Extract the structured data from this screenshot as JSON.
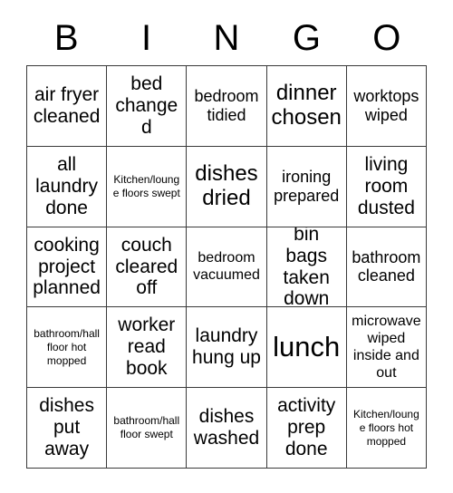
{
  "card": {
    "header_letters": [
      "B",
      "I",
      "N",
      "G",
      "O"
    ],
    "columns": 5,
    "rows": 5,
    "border_color": "#3a3a3a",
    "background_color": "#ffffff",
    "text_color": "#000000",
    "cells": [
      {
        "text": "air fryer cleaned",
        "size": "md"
      },
      {
        "text": "bed changed",
        "size": "md"
      },
      {
        "text": "bedroom tidied",
        "size": "sm"
      },
      {
        "text": "dinner chosen",
        "size": "lg"
      },
      {
        "text": "worktops wiped",
        "size": "sm"
      },
      {
        "text": "all laundry done",
        "size": "md"
      },
      {
        "text": "Kitchen/lounge floors swept",
        "size": "xxs"
      },
      {
        "text": "dishes dried",
        "size": "lg"
      },
      {
        "text": "ironing prepared",
        "size": "sm"
      },
      {
        "text": "living room dusted",
        "size": "md"
      },
      {
        "text": "cooking project planned",
        "size": "md"
      },
      {
        "text": "couch cleared off",
        "size": "md"
      },
      {
        "text": "bedroom vacuumed",
        "size": "xs"
      },
      {
        "text": "bin bags taken down",
        "size": "md"
      },
      {
        "text": "bathroom cleaned",
        "size": "sm"
      },
      {
        "text": "bathroom/hall floor hot mopped",
        "size": "xxs"
      },
      {
        "text": "worker read book",
        "size": "md"
      },
      {
        "text": "laundry hung up",
        "size": "md"
      },
      {
        "text": "lunch",
        "size": "xl"
      },
      {
        "text": "microwave wiped inside and out",
        "size": "xs"
      },
      {
        "text": "dishes put away",
        "size": "md"
      },
      {
        "text": "bathroom/hall floor swept",
        "size": "xxs"
      },
      {
        "text": "dishes washed",
        "size": "md"
      },
      {
        "text": "activity prep done",
        "size": "md"
      },
      {
        "text": "Kitchen/lounge floors hot mopped",
        "size": "xxs"
      }
    ]
  }
}
